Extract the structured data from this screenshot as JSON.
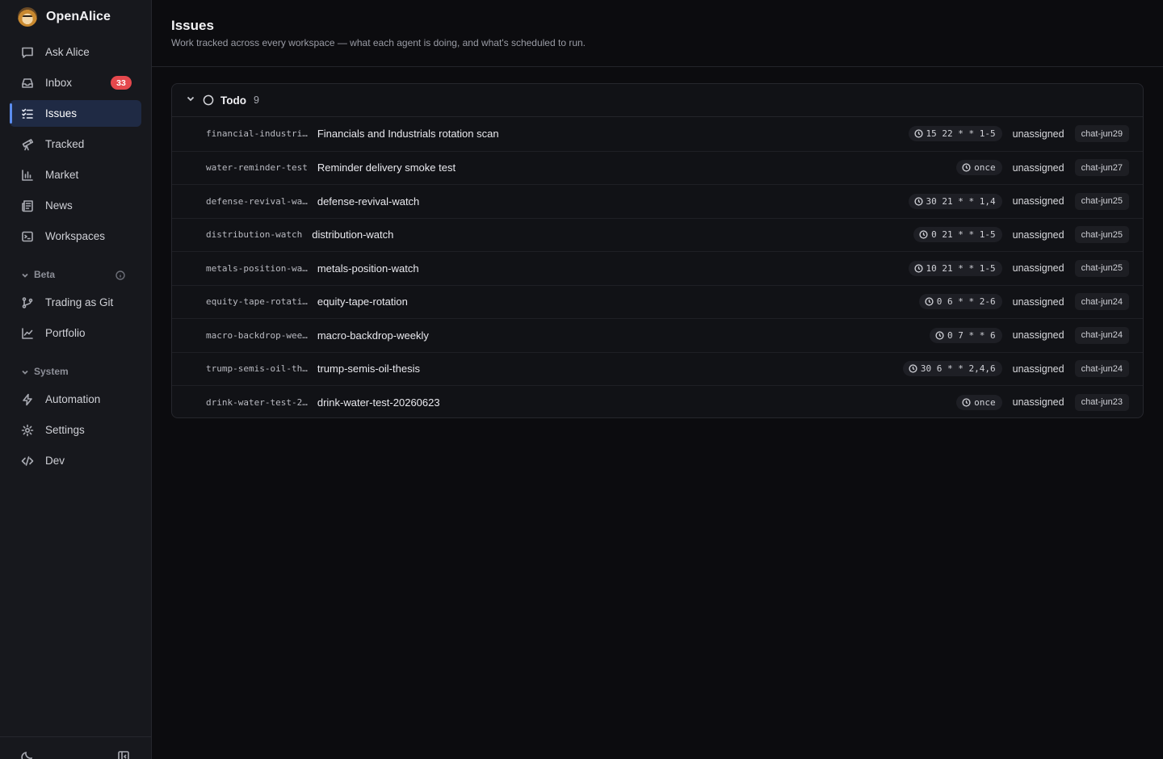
{
  "app": {
    "name": "OpenAlice"
  },
  "sidebar": {
    "items": [
      {
        "key": "ask-alice",
        "label": "Ask Alice",
        "icon": "chat-bubble-icon"
      },
      {
        "key": "inbox",
        "label": "Inbox",
        "icon": "inbox-icon",
        "badge": "33"
      },
      {
        "key": "issues",
        "label": "Issues",
        "icon": "checklist-icon",
        "active": true
      },
      {
        "key": "tracked",
        "label": "Tracked",
        "icon": "telescope-icon"
      },
      {
        "key": "market",
        "label": "Market",
        "icon": "bar-chart-icon"
      },
      {
        "key": "news",
        "label": "News",
        "icon": "newspaper-icon"
      },
      {
        "key": "workspaces",
        "label": "Workspaces",
        "icon": "terminal-icon"
      }
    ],
    "beta": {
      "label": "Beta",
      "items": [
        {
          "key": "trading-as-git",
          "label": "Trading as Git",
          "icon": "git-branch-icon"
        },
        {
          "key": "portfolio",
          "label": "Portfolio",
          "icon": "line-chart-icon"
        }
      ]
    },
    "system": {
      "label": "System",
      "items": [
        {
          "key": "automation",
          "label": "Automation",
          "icon": "lightning-icon"
        },
        {
          "key": "settings",
          "label": "Settings",
          "icon": "gear-icon"
        },
        {
          "key": "dev",
          "label": "Dev",
          "icon": "code-icon"
        }
      ]
    }
  },
  "page": {
    "title": "Issues",
    "subtitle": "Work tracked across every workspace — what each agent is doing, and what's scheduled to run."
  },
  "group": {
    "label": "Todo",
    "count": "9"
  },
  "issues": [
    {
      "id": "financial-industri…",
      "title": "Financials and Industrials rotation scan",
      "schedule": "15 22 * * 1-5",
      "assignee": "unassigned",
      "workspace": "chat-jun29"
    },
    {
      "id": "water-reminder-test",
      "title": "Reminder delivery smoke test",
      "schedule": "once",
      "assignee": "unassigned",
      "workspace": "chat-jun27"
    },
    {
      "id": "defense-revival-wa…",
      "title": "defense-revival-watch",
      "schedule": "30 21 * * 1,4",
      "assignee": "unassigned",
      "workspace": "chat-jun25"
    },
    {
      "id": "distribution-watch",
      "title": "distribution-watch",
      "schedule": "0 21 * * 1-5",
      "assignee": "unassigned",
      "workspace": "chat-jun25"
    },
    {
      "id": "metals-position-wa…",
      "title": "metals-position-watch",
      "schedule": "10 21 * * 1-5",
      "assignee": "unassigned",
      "workspace": "chat-jun25"
    },
    {
      "id": "equity-tape-rotati…",
      "title": "equity-tape-rotation",
      "schedule": "0 6 * * 2-6",
      "assignee": "unassigned",
      "workspace": "chat-jun24"
    },
    {
      "id": "macro-backdrop-wee…",
      "title": "macro-backdrop-weekly",
      "schedule": "0 7 * * 6",
      "assignee": "unassigned",
      "workspace": "chat-jun24"
    },
    {
      "id": "trump-semis-oil-th…",
      "title": "trump-semis-oil-thesis",
      "schedule": "30 6 * * 2,4,6",
      "assignee": "unassigned",
      "workspace": "chat-jun24"
    },
    {
      "id": "drink-water-test-2…",
      "title": "drink-water-test-20260623",
      "schedule": "once",
      "assignee": "unassigned",
      "workspace": "chat-jun23"
    }
  ]
}
